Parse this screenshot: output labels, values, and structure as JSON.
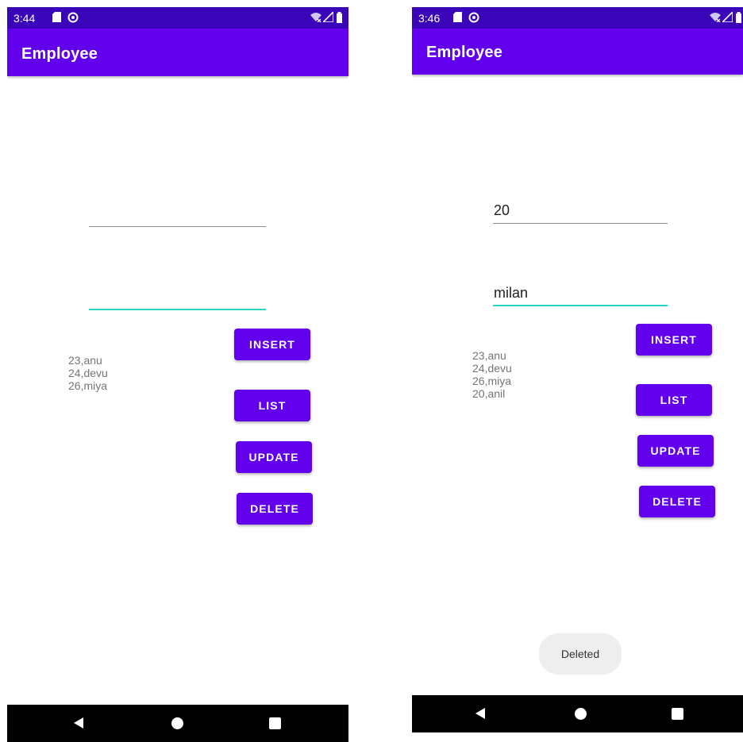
{
  "colors": {
    "status_bar": "#3a04b8",
    "app_bar": "#6200ee",
    "button": "#6200ee",
    "focused_underline": "#26d7c7",
    "nav_bar": "#000000"
  },
  "left": {
    "status": {
      "time": "3:44",
      "icons": [
        "sd-card-icon",
        "at-sign-icon",
        "wifi-icon",
        "signal-icon",
        "battery-icon"
      ]
    },
    "app_title": "Employee",
    "id_field": {
      "value": ""
    },
    "name_field": {
      "value": "",
      "focused": true
    },
    "buttons": {
      "insert": "INSERT",
      "list": "LIST",
      "update": "UPDATE",
      "delete": "DELETE"
    },
    "employees": [
      "23,anu",
      "24,devu",
      "26,miya"
    ],
    "nav": [
      "back-icon",
      "home-icon",
      "recents-icon"
    ]
  },
  "right": {
    "status": {
      "time": "3:46",
      "icons": [
        "sd-card-icon",
        "at-sign-icon",
        "wifi-icon",
        "signal-icon",
        "battery-icon"
      ]
    },
    "app_title": "Employee",
    "id_field": {
      "value": "20"
    },
    "name_field": {
      "value": "milan",
      "focused": true
    },
    "buttons": {
      "insert": "INSERT",
      "list": "LIST",
      "update": "UPDATE",
      "delete": "DELETE"
    },
    "employees": [
      "23,anu",
      "24,devu",
      "26,miya",
      "20,anil"
    ],
    "toast": "Deleted",
    "nav": [
      "back-icon",
      "home-icon",
      "recents-icon"
    ]
  }
}
